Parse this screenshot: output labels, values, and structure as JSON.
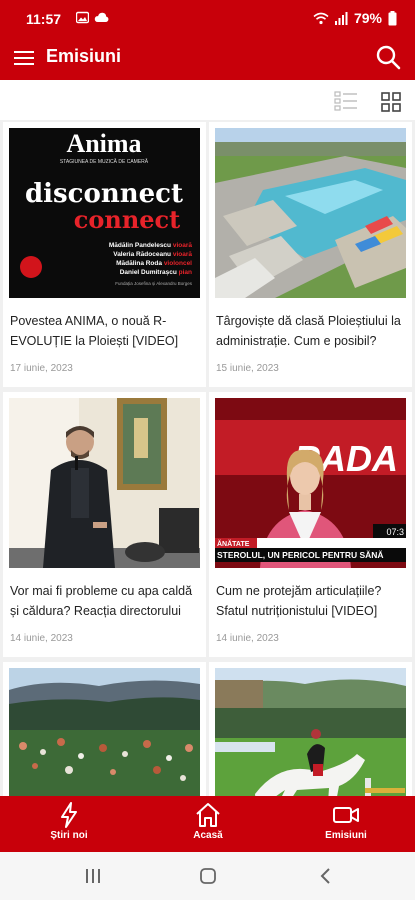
{
  "status": {
    "time": "11:57",
    "battery": "79%"
  },
  "appbar": {
    "title": "Emisiuni"
  },
  "articles": [
    {
      "title": "Povestea ANIMA, o nouă R-EVOLUȚIE la Ploiești [VIDEO]",
      "date": "17 iunie, 2023",
      "poster": {
        "brand": "Anima",
        "subtitle": "STAGIUNEA DE MUZICĂ DE CAMERĂ",
        "line1": "disconnect",
        "line2": "connect",
        "performers": [
          {
            "name": "Mădălin Pandelescu",
            "role": "vioară"
          },
          {
            "name": "Valeria Rădoceanu",
            "role": "vioară"
          },
          {
            "name": "Mădălina Roda",
            "role": "violoncel"
          },
          {
            "name": "Daniel Dumitrașcu",
            "role": "pian"
          }
        ],
        "sponsor": "Fundația Josefina și Alexandru Borges"
      }
    },
    {
      "title": "Târgoviște dă clasă Ploieștiului la administrație. Cum e posibil?",
      "date": "15 iunie, 2023"
    },
    {
      "title": "Vor mai fi probleme cu apa caldă și căldura? Reacția directorului",
      "date": "14 iunie, 2023"
    },
    {
      "title": "Cum ne protejăm articulațiile? Sfatul nutriționistului [VIDEO]",
      "date": "14 iunie, 2023",
      "tv": {
        "brand": "RADA",
        "time": "07:3",
        "ticker_left": "ĂNĂTATE",
        "ticker": "STEROLUL, UN PERICOL PENTRU SĂNĂ"
      }
    },
    {
      "title": "",
      "date": ""
    },
    {
      "title": "",
      "date": ""
    }
  ],
  "nav": {
    "stiri": "Știri noi",
    "acasa": "Acasă",
    "emisiuni": "Emisiuni"
  },
  "colors": {
    "primary": "#c8000a",
    "background": "#f0f0f0"
  },
  "icons": [
    "menu-icon",
    "search-icon",
    "list-view-icon",
    "grid-view-icon",
    "lightning-icon",
    "home-icon",
    "video-camera-icon"
  ]
}
